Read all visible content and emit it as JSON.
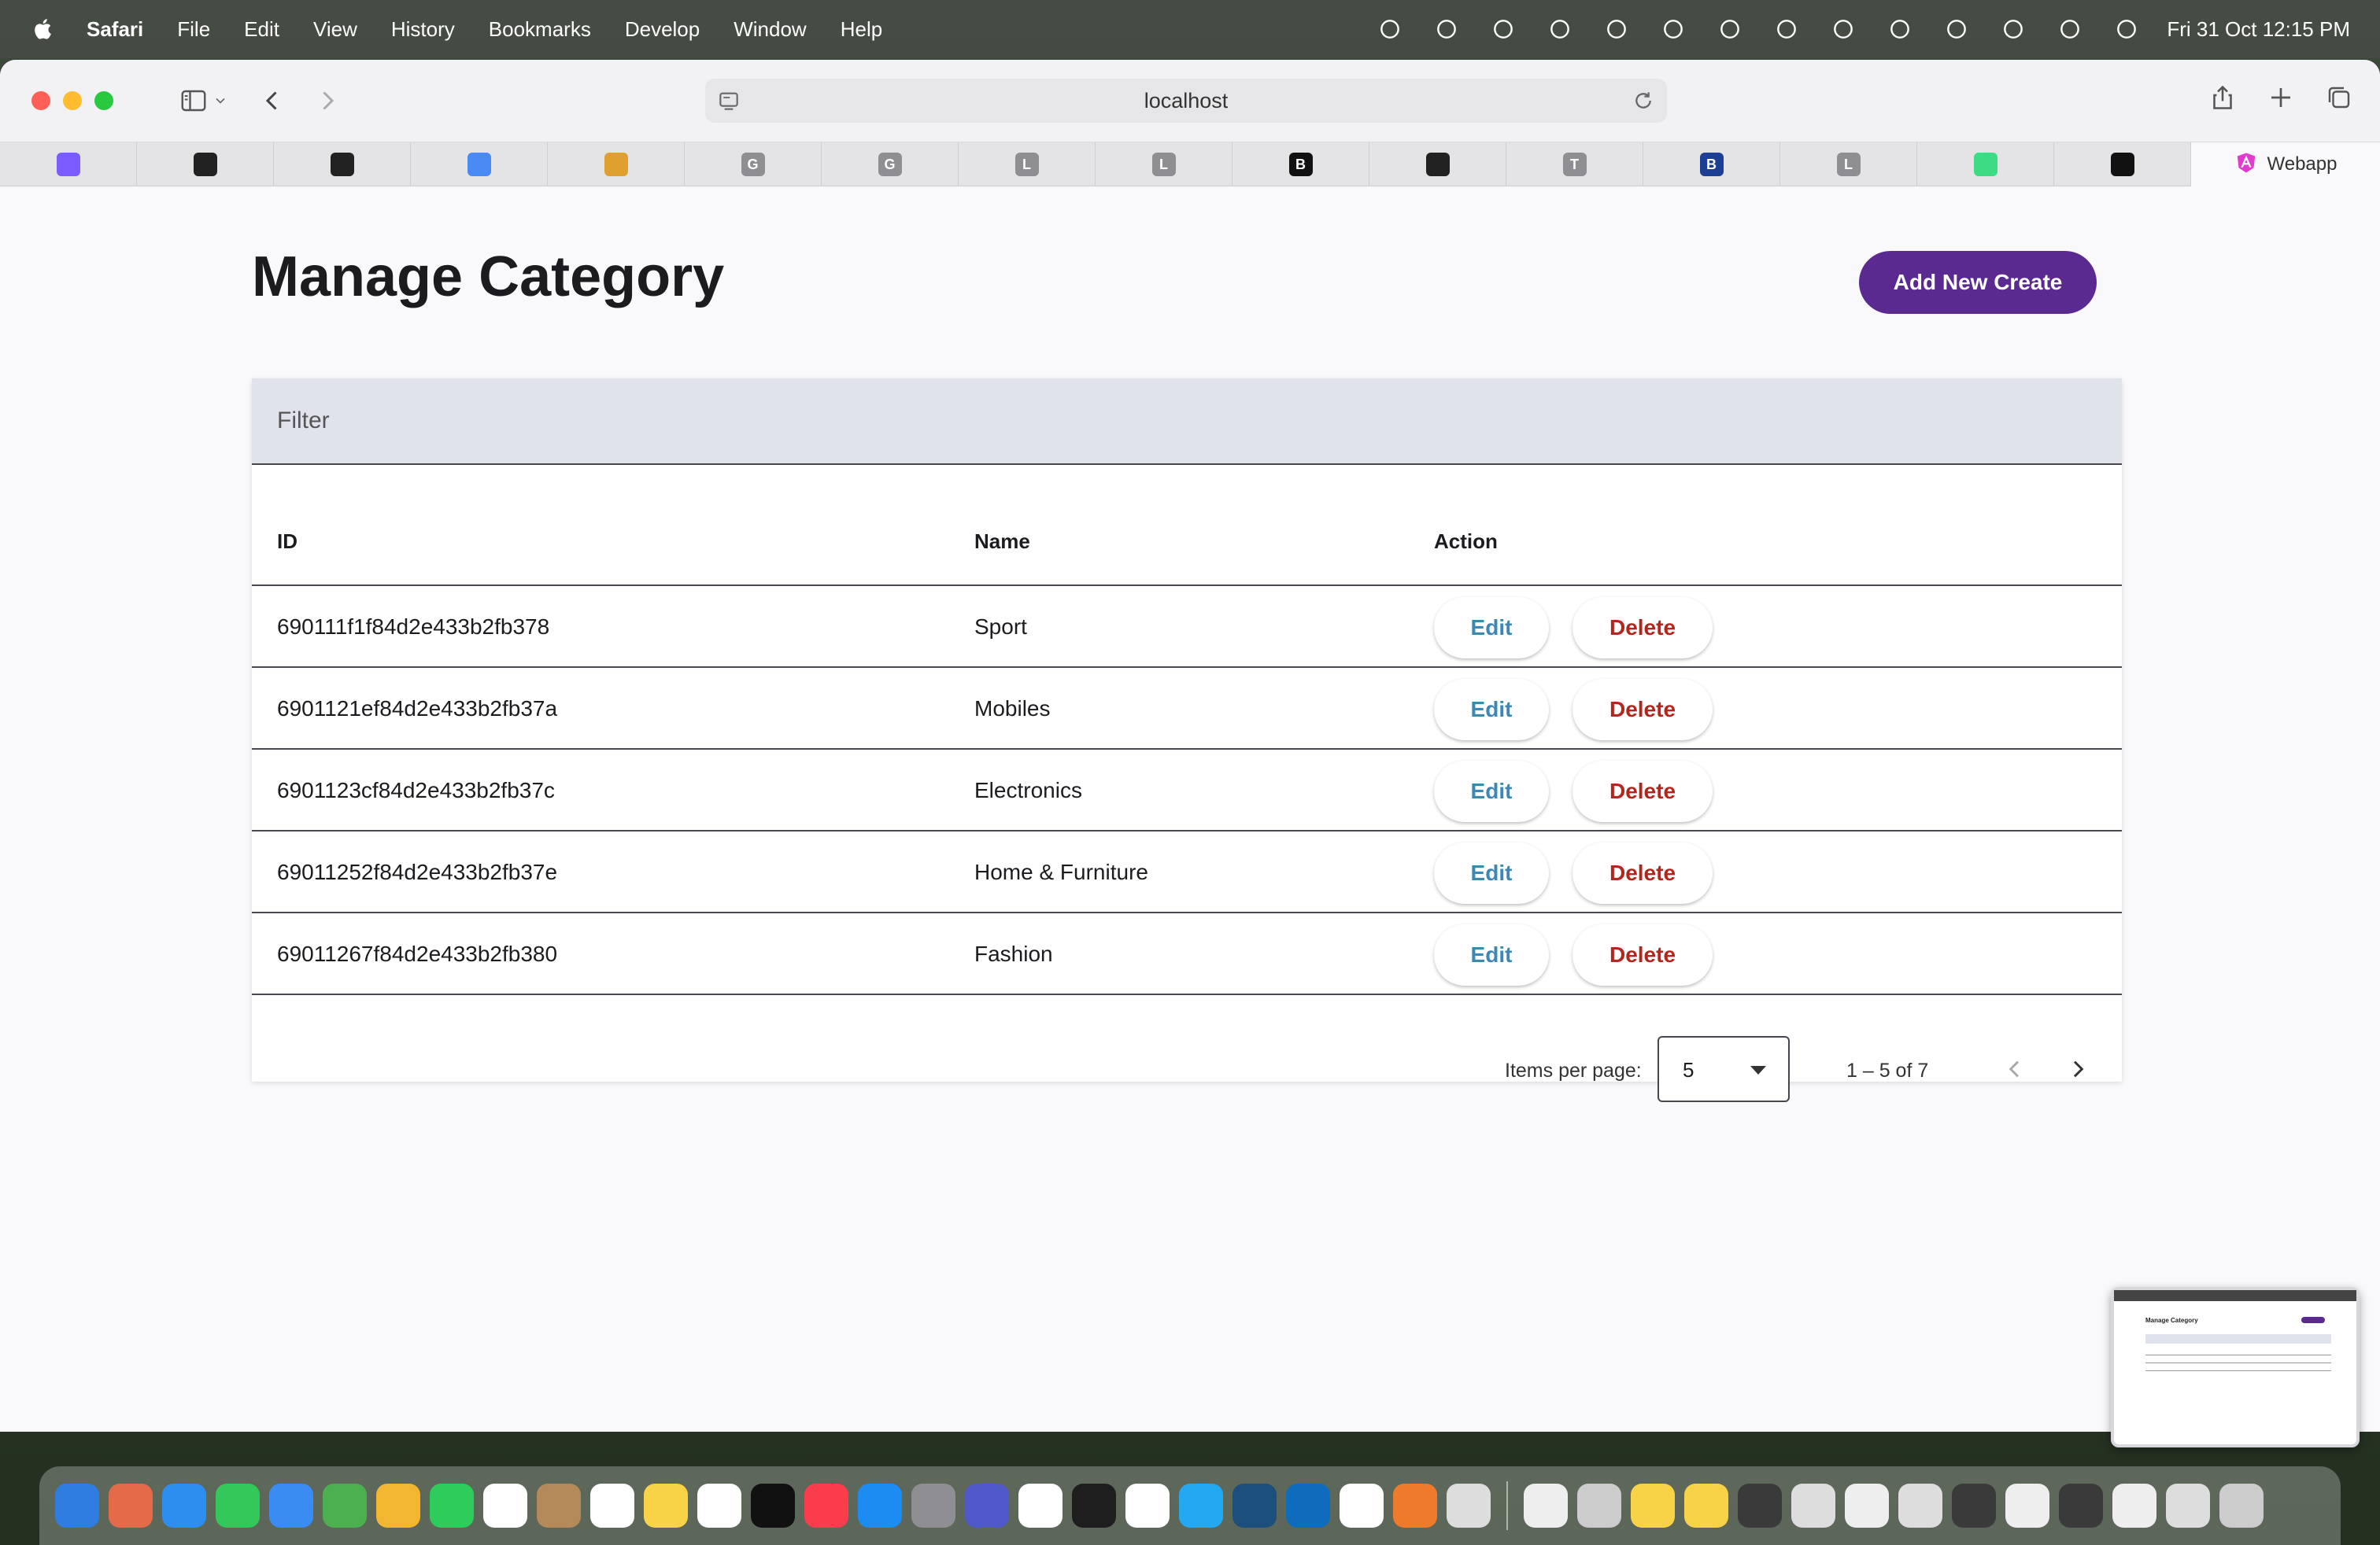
{
  "menubar": {
    "app_name": "Safari",
    "items": [
      "File",
      "Edit",
      "View",
      "History",
      "Bookmarks",
      "Develop",
      "Window",
      "Help"
    ],
    "clock": "Fri 31 Oct  12:15 PM",
    "status_icons": [
      "airplane-icon",
      "cloud-icon",
      "app-icon",
      "vpn-icon",
      "shield-icon",
      "lock-icon",
      "teams-icon",
      "key-icon",
      "play-icon",
      "battery-icon",
      "wifi-icon",
      "search-icon",
      "control-center-icon",
      "siri-icon"
    ]
  },
  "browser": {
    "address": "localhost",
    "tabs": [
      {
        "icon": "copilot-icon",
        "letter": "",
        "color": "#7b5cff"
      },
      {
        "icon": "github-icon",
        "letter": "",
        "color": "#222222"
      },
      {
        "icon": "x-icon",
        "letter": "",
        "color": "#222222"
      },
      {
        "icon": "gemini-icon",
        "letter": "",
        "color": "#4a8af4"
      },
      {
        "icon": "bottle-icon",
        "letter": "",
        "color": "#e0a030"
      },
      {
        "icon": "letter-icon",
        "letter": "G",
        "color": "#8e8e93"
      },
      {
        "icon": "letter-icon",
        "letter": "G",
        "color": "#8e8e93"
      },
      {
        "icon": "letter-icon",
        "letter": "L",
        "color": "#8e8e93"
      },
      {
        "icon": "letter-icon",
        "letter": "L",
        "color": "#8e8e93"
      },
      {
        "icon": "b-icon",
        "letter": "B",
        "color": "#111111"
      },
      {
        "icon": "github-icon",
        "letter": "",
        "color": "#222222"
      },
      {
        "icon": "letter-icon",
        "letter": "T",
        "color": "#8e8e93"
      },
      {
        "icon": "bank-icon",
        "letter": "B",
        "color": "#1c3f94"
      },
      {
        "icon": "letter-icon",
        "letter": "L",
        "color": "#8e8e93"
      },
      {
        "icon": "android-icon",
        "letter": "",
        "color": "#3ddc84"
      },
      {
        "icon": "app-icon",
        "letter": "",
        "color": "#111111"
      }
    ],
    "active_tab": {
      "title": "Webapp",
      "icon": "angular-icon"
    }
  },
  "page": {
    "title": "Manage Category",
    "add_button": "Add New Create",
    "filter_label": "Filter",
    "columns": {
      "id": "ID",
      "name": "Name",
      "action": "Action"
    },
    "rows": [
      {
        "id": "690111f1f84d2e433b2fb378",
        "name": "Sport",
        "edit": "Edit",
        "delete": "Delete"
      },
      {
        "id": "6901121ef84d2e433b2fb37a",
        "name": "Mobiles",
        "edit": "Edit",
        "delete": "Delete"
      },
      {
        "id": "6901123cf84d2e433b2fb37c",
        "name": "Electronics",
        "edit": "Edit",
        "delete": "Delete"
      },
      {
        "id": "69011252f84d2e433b2fb37e",
        "name": "Home & Furniture",
        "edit": "Edit",
        "delete": "Delete"
      },
      {
        "id": "69011267f84d2e433b2fb380",
        "name": "Fashion",
        "edit": "Edit",
        "delete": "Delete"
      }
    ],
    "paginator": {
      "label": "Items per page:",
      "page_size": "5",
      "range": "1 – 5 of 7"
    }
  },
  "dock": {
    "apps": [
      {
        "name": "finder-icon",
        "color": "#2f7de1"
      },
      {
        "name": "launchpad-icon",
        "color": "#e56a4a"
      },
      {
        "name": "safari-icon",
        "color": "#2d8ef0"
      },
      {
        "name": "messages-icon",
        "color": "#34c759"
      },
      {
        "name": "mail-icon",
        "color": "#3a8cf2"
      },
      {
        "name": "maps-icon",
        "color": "#4caf50"
      },
      {
        "name": "photos-icon",
        "color": "#f2b630"
      },
      {
        "name": "facetime-icon",
        "color": "#2ecc5a"
      },
      {
        "name": "calendar-icon",
        "color": "#ffffff"
      },
      {
        "name": "contacts-icon",
        "color": "#b58a5a"
      },
      {
        "name": "reminders-icon",
        "color": "#ffffff"
      },
      {
        "name": "notes-icon",
        "color": "#f8d347"
      },
      {
        "name": "freeform-icon",
        "color": "#ffffff"
      },
      {
        "name": "tv-icon",
        "color": "#111111"
      },
      {
        "name": "music-icon",
        "color": "#fa3c4c"
      },
      {
        "name": "app-store-icon",
        "color": "#1c8cf3"
      },
      {
        "name": "settings-icon",
        "color": "#8e8e93"
      },
      {
        "name": "teams-icon",
        "color": "#5059c9"
      },
      {
        "name": "chrome-icon",
        "color": "#ffffff"
      },
      {
        "name": "terminal-icon",
        "color": "#1e1e1e"
      },
      {
        "name": "mongodb-icon",
        "color": "#ffffff"
      },
      {
        "name": "vscode-icon",
        "color": "#23a9f2"
      },
      {
        "name": "mysql-workbench-icon",
        "color": "#1d4f7c"
      },
      {
        "name": "outlook-icon",
        "color": "#0f6cbd"
      },
      {
        "name": "xcode-icon",
        "color": "#ffffff"
      },
      {
        "name": "pencil-icon",
        "color": "#f07a2c"
      },
      {
        "name": "preview-icon",
        "color": "#dddddd"
      }
    ],
    "recent": [
      {
        "name": "document-icon",
        "color": "#eeeeee"
      },
      {
        "name": "window-icon",
        "color": "#cccccc"
      },
      {
        "name": "folder-icon",
        "color": "#f8d347"
      },
      {
        "name": "folder-icon",
        "color": "#f8d347"
      },
      {
        "name": "window-icon",
        "color": "#3a3a3a"
      },
      {
        "name": "window-icon",
        "color": "#dddddd"
      },
      {
        "name": "window-icon",
        "color": "#eeeeee"
      },
      {
        "name": "window-icon",
        "color": "#dddddd"
      },
      {
        "name": "window-icon",
        "color": "#3a3a3a"
      },
      {
        "name": "window-icon",
        "color": "#eeeeee"
      },
      {
        "name": "window-icon",
        "color": "#3a3a3a"
      },
      {
        "name": "window-icon",
        "color": "#eeeeee"
      },
      {
        "name": "window-icon",
        "color": "#dddddd"
      },
      {
        "name": "trash-icon",
        "color": "#cccccc"
      }
    ]
  },
  "colors": {
    "primary": "#5b2a91",
    "edit": "#3b88b5",
    "delete": "#b3261e"
  }
}
